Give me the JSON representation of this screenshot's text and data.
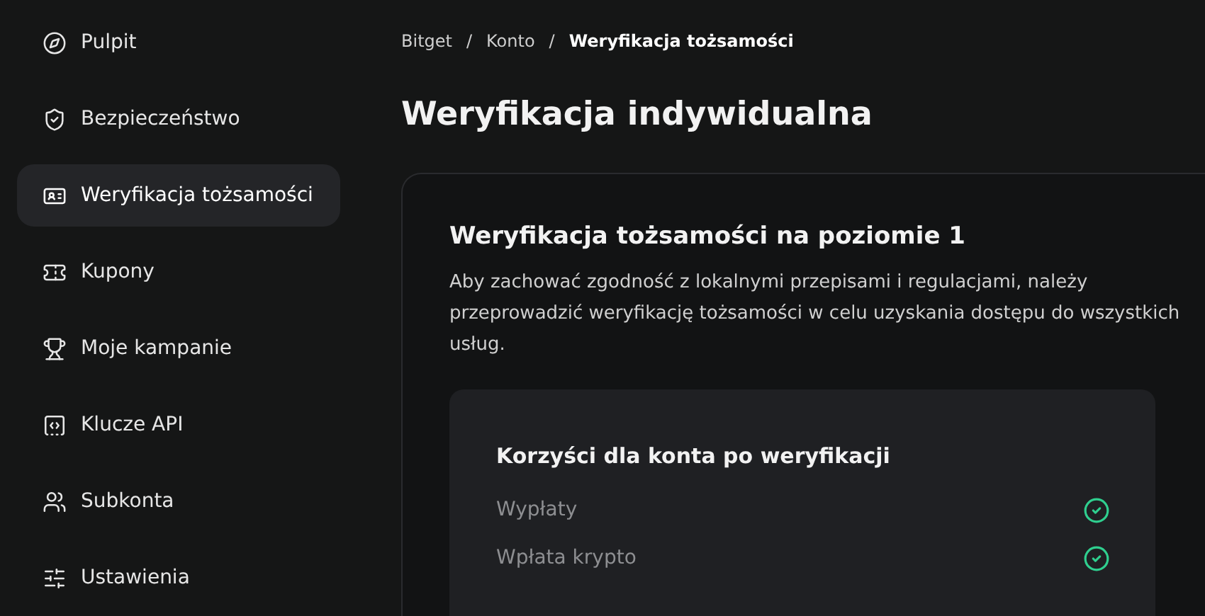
{
  "sidebar": {
    "items": [
      {
        "label": "Pulpit",
        "selected": false
      },
      {
        "label": "Bezpieczeństwo",
        "selected": false
      },
      {
        "label": "Weryfikacja tożsamości",
        "selected": true
      },
      {
        "label": "Kupony",
        "selected": false
      },
      {
        "label": "Moje kampanie",
        "selected": false
      },
      {
        "label": "Klucze API",
        "selected": false
      },
      {
        "label": "Subkonta",
        "selected": false
      },
      {
        "label": "Ustawienia",
        "selected": false
      }
    ]
  },
  "breadcrumb": [
    {
      "kind": "link",
      "text": "Bitget"
    },
    {
      "kind": "separator",
      "text": "/"
    },
    {
      "kind": "link",
      "text": "Konto"
    },
    {
      "kind": "separator",
      "text": "/"
    },
    {
      "kind": "current",
      "text": "Weryfikacja tożsamości"
    }
  ],
  "page_title": "Weryfikacja indywidualna",
  "card": {
    "title": "Weryfikacja tożsamości na poziomie 1",
    "description": "Aby zachować zgodność z lokalnymi przepisami i regulacjami, należy przeprowadzić weryfikację tożsamości w celu uzyskania dostępu do wszystkich usług.",
    "benefits": {
      "title": "Korzyści dla konta po weryfikacji",
      "items": [
        {
          "label": "Wypłaty",
          "checked": true
        },
        {
          "label": "Wpłata krypto",
          "checked": true
        }
      ]
    }
  }
}
